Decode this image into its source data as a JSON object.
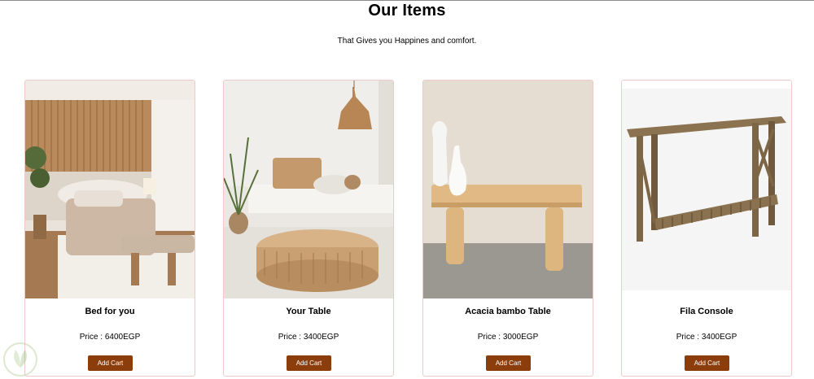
{
  "header": {
    "title": "Our Items",
    "subtitle": "That Gives you Happines and comfort."
  },
  "products": [
    {
      "name": "Bed for you",
      "price": "Price : 6400EGP",
      "button": "Add Cart"
    },
    {
      "name": "Your Table",
      "price": "Price : 3400EGP",
      "button": "Add Cart"
    },
    {
      "name": "Acacia bambo Table",
      "price": "Price : 3000EGP",
      "button": "Add Cart"
    },
    {
      "name": "Fila Console",
      "price": "Price : 3400EGP",
      "button": "Add Cart"
    }
  ],
  "colors": {
    "button": "#8b3d0c",
    "card_border": "#f0c9c9"
  },
  "icons": {
    "watermark": "leaf-logo-icon"
  }
}
